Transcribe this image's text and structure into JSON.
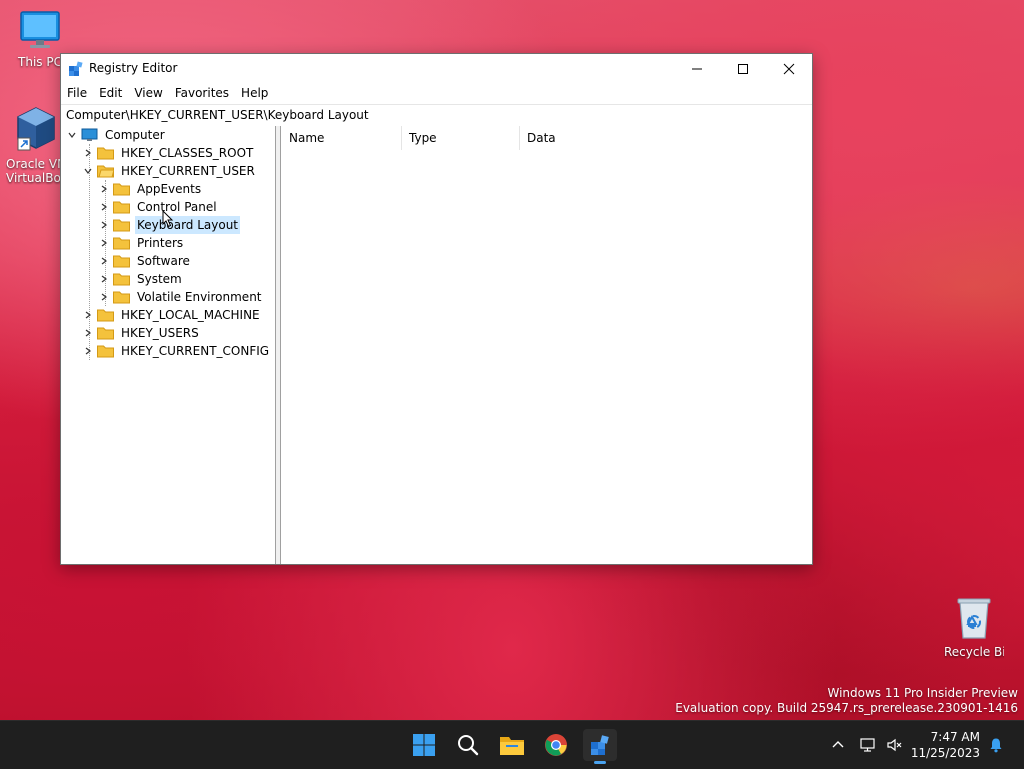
{
  "desktop": {
    "icons": [
      {
        "label": "This PC"
      },
      {
        "label": "Oracle VM VirtualBox",
        "line1": "Oracle VM",
        "line2": "VirtualBox"
      },
      {
        "label": "Recycle Bin"
      }
    ],
    "watermark": {
      "line1": "Windows 11 Pro Insider Preview",
      "line2": "Evaluation copy. Build 25947.rs_prerelease.230901-1416"
    }
  },
  "window": {
    "title": "Registry Editor",
    "menu": [
      "File",
      "Edit",
      "View",
      "Favorites",
      "Help"
    ],
    "address": "Computer\\HKEY_CURRENT_USER\\Keyboard Layout",
    "tree": {
      "root": "Computer",
      "hives": [
        "HKEY_CLASSES_ROOT",
        "HKEY_CURRENT_USER",
        "HKEY_LOCAL_MACHINE",
        "HKEY_USERS",
        "HKEY_CURRENT_CONFIG"
      ],
      "current_user_children": [
        "AppEvents",
        "Control Panel",
        "Keyboard Layout",
        "Printers",
        "Software",
        "System",
        "Volatile Environment"
      ],
      "selected": "Keyboard Layout"
    },
    "columns": [
      "Name",
      "Type",
      "Data"
    ]
  },
  "taskbar": {
    "apps": [
      "start-icon",
      "search-icon",
      "file-explorer-icon",
      "chrome-icon",
      "registry-editor-icon"
    ],
    "clock": {
      "time": "7:47 AM",
      "date": "11/25/2023"
    }
  },
  "colors": {
    "selection": "#cce8ff",
    "folder": "#f4c23c",
    "taskbar": "#1f1f1f",
    "start_blue": "#3aa0f0"
  }
}
